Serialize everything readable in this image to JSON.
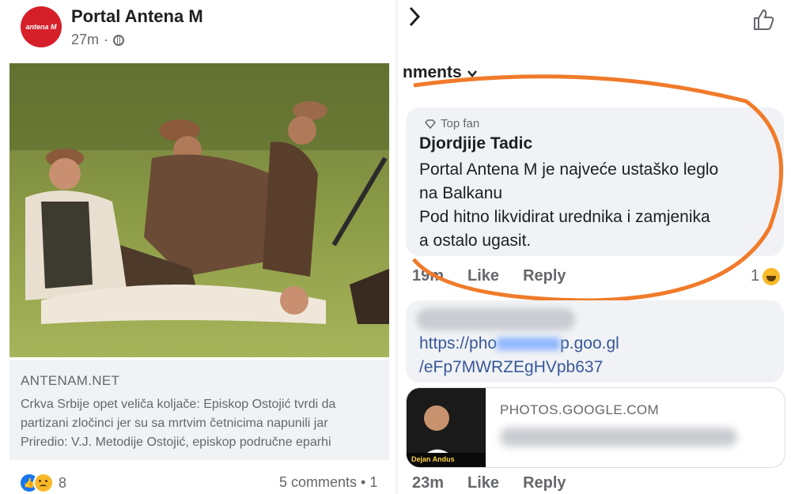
{
  "post": {
    "page_name": "Portal Antena M",
    "avatar_text": "antena M",
    "time": "27m",
    "link_domain": "ANTENAM.NET",
    "link_lines": [
      "Crkva Srbije opet veliča koljače: Episkop Ostojić tvrdi da",
      "partizani zločinci jer su sa mrtvim četnicima napunili jar",
      "Priredio: V.J. Metodije Ostojić, episkop područne eparhi"
    ],
    "reaction_count": "8",
    "comments_count": "5 comments • 1"
  },
  "comments": {
    "sort_label": "nments",
    "first": {
      "badge": "Top fan",
      "author": "Djordjije Tadic",
      "lines": [
        "Portal Antena M je najveće ustaško leglo",
        "na Balkanu",
        "Pod hitno likvidirat urednika i zamjenika",
        "a ostalo ugasit."
      ],
      "time": "19m",
      "like": "Like",
      "reply": "Reply",
      "reaction_count": "1"
    },
    "second": {
      "link_start": "https://pho",
      "link_end": "p.goo.gl",
      "link_line2": "/eFp7MWRZEgHVpb637",
      "preview_domain": "PHOTOS.GOOGLE.COM",
      "thumb_label": "Dejan Andus",
      "time": "23m",
      "like": "Like",
      "reply": "Reply"
    }
  },
  "colors": {
    "annotation_circle": "#f07b2a",
    "link_blue": "#385898",
    "avatar_red": "#d5202a"
  },
  "icons": [
    "globe-icon",
    "chevron-right-icon",
    "thumbs-up-icon",
    "chevron-down-icon",
    "diamond-icon",
    "like-reaction-icon",
    "sad-reaction-icon",
    "haha-reaction-icon"
  ]
}
